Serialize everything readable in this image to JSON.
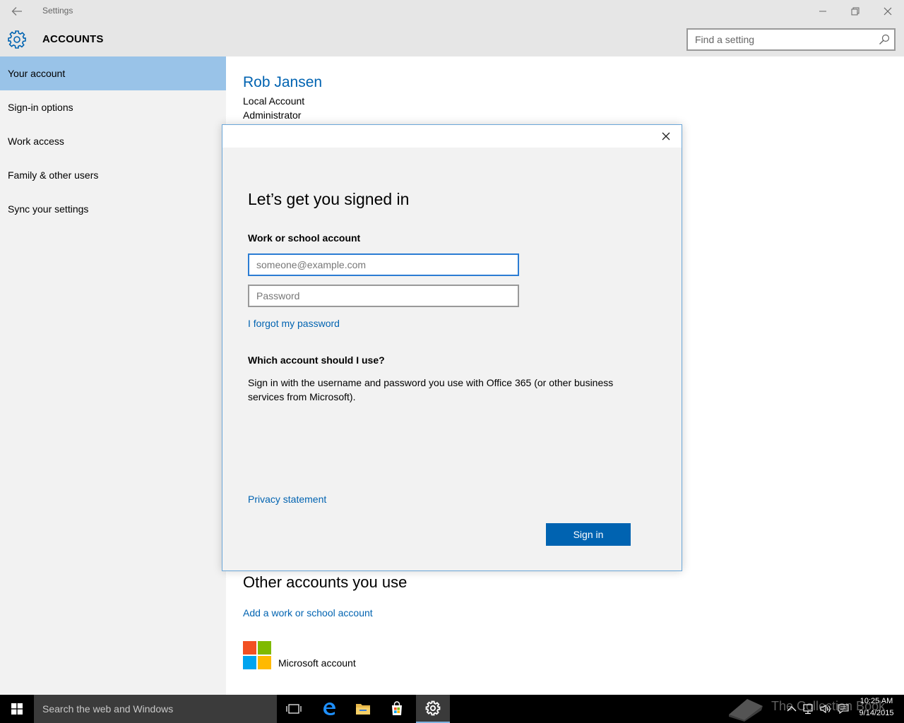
{
  "window": {
    "title": "Settings",
    "back_icon": "arrow-left-icon",
    "minimize_icon": "minimize-icon",
    "restore_icon": "restore-icon",
    "close_icon": "close-icon"
  },
  "header": {
    "icon": "gear-icon",
    "title": "ACCOUNTS",
    "search_placeholder": "Find a setting",
    "search_icon": "search-icon"
  },
  "sidebar": {
    "items": [
      {
        "label": "Your account",
        "active": true
      },
      {
        "label": "Sign-in options",
        "active": false
      },
      {
        "label": "Work access",
        "active": false
      },
      {
        "label": "Family & other users",
        "active": false
      },
      {
        "label": "Sync your settings",
        "active": false
      }
    ]
  },
  "main": {
    "user_name": "Rob Jansen",
    "user_type": "Local Account",
    "user_role": "Administrator",
    "other_accounts_title": "Other accounts you use",
    "add_work_link": "Add a work or school account",
    "microsoft_account_label": "Microsoft account",
    "ms_logo_colors": [
      "#f25022",
      "#7fba00",
      "#00a4ef",
      "#ffb900"
    ]
  },
  "dialog": {
    "heading": "Let’s get you signed in",
    "account_label": "Work or school account",
    "email_placeholder": "someone@example.com",
    "password_placeholder": "Password",
    "forgot_link": "I forgot my password",
    "which_title": "Which account should I use?",
    "which_text": "Sign in with the username and password you use with Office 365 (or other business services from Microsoft).",
    "privacy_link": "Privacy statement",
    "signin_button": "Sign in",
    "close_icon": "close-icon"
  },
  "taskbar": {
    "search_text": "Search the web and Windows",
    "watermark_text": "The Collection Book",
    "time": "10:25 AM",
    "date": "9/14/2015",
    "icons": [
      "windows-start-icon",
      "task-view-icon",
      "edge-icon",
      "file-explorer-icon",
      "store-icon",
      "settings-gear-icon"
    ],
    "tray_icons": [
      "chevron-up-icon",
      "network-icon",
      "volume-icon",
      "action-center-icon"
    ]
  },
  "colors": {
    "accent": "#0063b1",
    "sidebar_active": "#99c3e8",
    "chrome": "#e6e6e6",
    "sidebar_bg": "#f2f2f2"
  }
}
